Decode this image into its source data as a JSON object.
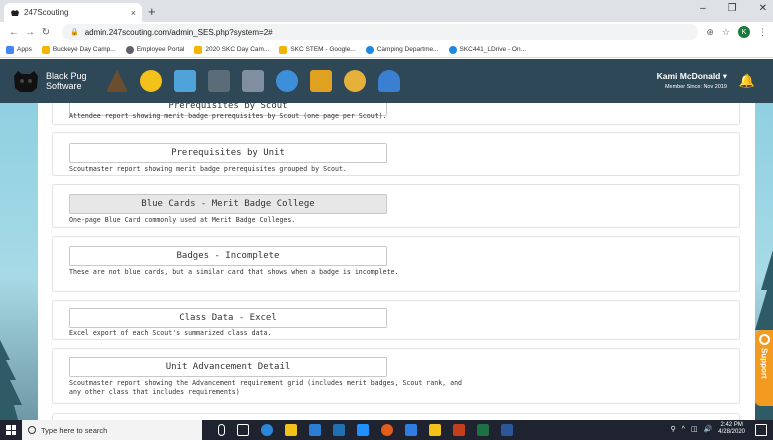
{
  "browser": {
    "tab_title": "247Scouting",
    "tab_close": "×",
    "new_tab": "+",
    "url": "admin.247scouting.com/admin_SES.php?system=2#",
    "controls": {
      "minimize": "–",
      "restore": "❐",
      "close": "✕"
    }
  },
  "bookmarks": [
    {
      "label": "Apps",
      "color": "#4285f4"
    },
    {
      "label": "Buckeye Day Camp...",
      "color": "#f4b400"
    },
    {
      "label": "Employee Portal",
      "color": "#5f6368"
    },
    {
      "label": "2020 SKC Day Cam...",
      "color": "#f4b400"
    },
    {
      "label": "SKC STEM - Google...",
      "color": "#f4b400"
    },
    {
      "label": "Camping Departme...",
      "color": "#1e88e5"
    },
    {
      "label": "SKC441_LDrive - On...",
      "color": "#1e88e5"
    }
  ],
  "header": {
    "brand": "Black Pug Software",
    "user_name": "Kami McDonald ▾",
    "member_since": "Member Since: Nov 2019",
    "app_icon_colors": [
      "#6b4e2e",
      "#f2c21b",
      "#4fa3d9",
      "#5b6b78",
      "#7f8fa0",
      "#3c8fd8",
      "#e0a020",
      "#e6b13a",
      "#3a7fd0"
    ]
  },
  "reports": [
    {
      "button": "Prerequisites by Scout",
      "description": "Attendee report showing merit badge prerequisites by Scout (one page per Scout).",
      "active": false
    },
    {
      "button": "Prerequisites by Unit",
      "description": "Scoutmaster report showing merit badge prerequisites grouped by Scout.",
      "active": false
    },
    {
      "button": "Blue Cards - Merit Badge College",
      "description": "One-page Blue Card commonly used at Merit Badge Colleges.",
      "active": true
    },
    {
      "button": "Badges - Incomplete",
      "description": "These are not blue cards, but a similar card that shows when a badge is incomplete.",
      "active": false
    },
    {
      "button": "Class Data - Excel",
      "description": "Excel export of each Scout's summarized class data.",
      "active": false
    },
    {
      "button": "Unit Advancement Detail",
      "description": "Scoutmaster report showing the Advancement requirement grid (includes merit badges, Scout rank, and any other class that includes requirements)",
      "active": false
    }
  ],
  "support": {
    "label": "Support",
    "color": "#f39a20"
  },
  "taskbar": {
    "search_placeholder": "Type here to search",
    "time": "2:42 PM",
    "date": "4/28/2020",
    "app_colors": [
      "#ffffff",
      "#2b88d8",
      "#1e90ff",
      "#f2c21b",
      "#2b7cd3",
      "#1f6fb2",
      "#e25c1b",
      "#2f7de1",
      "#f2c21b",
      "#c43e1c",
      "#1e7145",
      "#2b579a"
    ]
  },
  "theme": {
    "header_bg": "#2f4858",
    "accent": "#f39a20"
  }
}
